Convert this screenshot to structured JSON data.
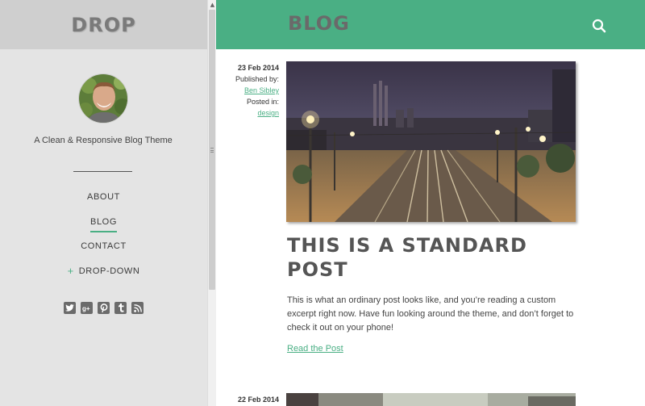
{
  "sidebar": {
    "site_title": "DROP",
    "tagline": "A Clean & Responsive Blog Theme",
    "nav": [
      {
        "label": "ABOUT"
      },
      {
        "label": "BLOG"
      },
      {
        "label": "CONTACT"
      },
      {
        "label": "DROP-DOWN",
        "prefix": "+"
      }
    ],
    "social": [
      "twitter-icon",
      "google-plus-icon",
      "pinterest-icon",
      "tumblr-icon",
      "rss-icon"
    ]
  },
  "header": {
    "title": "BLOG",
    "search_icon": "search-icon",
    "accent_color": "#4aaf84"
  },
  "posts": [
    {
      "date": "23 Feb 2014",
      "published_by_label": "Published by:",
      "author": "Ben Sibley",
      "posted_in_label": "Posted in:",
      "category": "design",
      "title": "THIS IS A STANDARD POST",
      "excerpt": "This is what an ordinary post looks like, and you’re reading a custom excerpt right now. Have fun looking around the theme, and don’t forget to check it out on your phone!",
      "read_more": "Read the Post"
    },
    {
      "date": "22 Feb 2014"
    }
  ]
}
